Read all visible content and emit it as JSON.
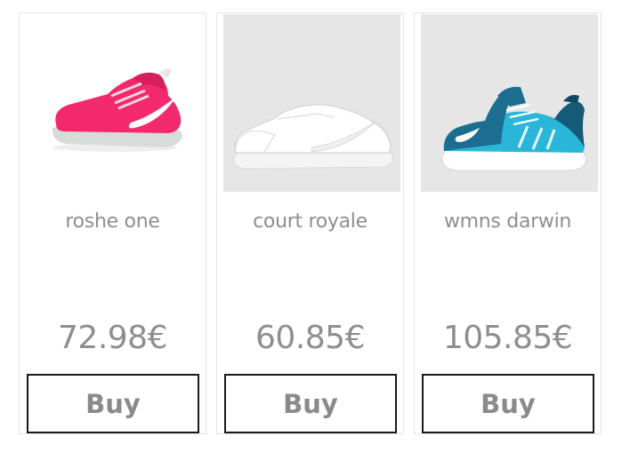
{
  "products": [
    {
      "name": "roshe one",
      "price": "72.98€",
      "buy_label": "Buy",
      "image_icon": "pink-sneaker-icon",
      "image_bg": "#ffffff",
      "shoe_color": "#f2296d"
    },
    {
      "name": "court royale",
      "price": "60.85€",
      "buy_label": "Buy",
      "image_icon": "white-sneaker-icon",
      "image_bg": "#e6e6e6",
      "shoe_color": "#fbfbfb"
    },
    {
      "name": "wmns darwin",
      "price": "105.85€",
      "buy_label": "Buy",
      "image_icon": "blue-sneaker-icon",
      "image_bg": "#e6e6e6",
      "shoe_color": "#2ab6d9"
    }
  ],
  "colors": {
    "text": "#8e8e8e",
    "button_border": "#1a1a1a",
    "card_border": "#e3e3e3"
  }
}
